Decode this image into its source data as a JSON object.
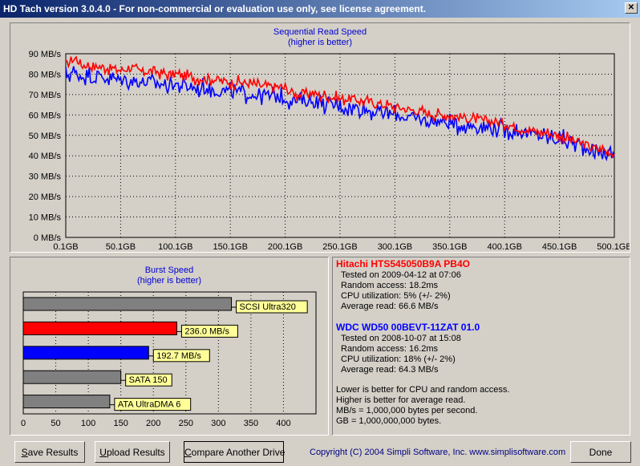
{
  "window": {
    "title": "HD Tach version 3.0.4.0  - For non-commercial or evaluation use only, see license agreement.",
    "close_glyph": "✕"
  },
  "seq_chart": {
    "title": "Sequential Read Speed",
    "subtitle": "(higher is better)",
    "y_ticks": [
      "0 MB/s",
      "10 MB/s",
      "20 MB/s",
      "30 MB/s",
      "40 MB/s",
      "50 MB/s",
      "60 MB/s",
      "70 MB/s",
      "80 MB/s",
      "90 MB/s"
    ],
    "x_ticks": [
      "0.1GB",
      "50.1GB",
      "100.1GB",
      "150.1GB",
      "200.1GB",
      "250.1GB",
      "300.1GB",
      "350.1GB",
      "400.1GB",
      "450.1GB",
      "500.1GB"
    ]
  },
  "burst_chart": {
    "title": "Burst Speed",
    "subtitle": "(higher is better)",
    "x_ticks": [
      "0",
      "50",
      "100",
      "150",
      "200",
      "250",
      "300",
      "350",
      "400"
    ]
  },
  "chart_data": [
    {
      "type": "line",
      "title": "Sequential Read Speed",
      "subtitle": "(higher is better)",
      "xlabel": "",
      "ylabel": "",
      "x_unit": "GB",
      "y_unit": "MB/s",
      "xlim": [
        0.1,
        500.1
      ],
      "ylim": [
        0,
        90
      ],
      "grid": true,
      "series": [
        {
          "name": "Hitachi HTS545050B9A PB4O",
          "color": "#ff0000",
          "x": [
            0.1,
            5,
            10,
            15,
            20,
            25,
            30,
            40,
            50,
            60,
            70,
            80,
            90,
            100,
            110,
            120,
            130,
            140,
            150,
            160,
            170,
            180,
            190,
            200,
            210,
            220,
            230,
            240,
            250,
            260,
            270,
            280,
            290,
            300,
            310,
            320,
            330,
            340,
            350,
            360,
            370,
            380,
            390,
            400,
            410,
            420,
            430,
            440,
            450,
            460,
            470,
            480,
            490,
            500.1
          ],
          "y": [
            84,
            87,
            88,
            84,
            85,
            83,
            84,
            83,
            82,
            83,
            81,
            82,
            80,
            80,
            79,
            78,
            78,
            77,
            76,
            76,
            75,
            74,
            74,
            73,
            70,
            71,
            70,
            69,
            68,
            68,
            67,
            66,
            65,
            64,
            63,
            62,
            61,
            60,
            60,
            59,
            58,
            57,
            57,
            56,
            54,
            53,
            52,
            51,
            50,
            48,
            46,
            44,
            43,
            41
          ]
        },
        {
          "name": "WDC WD50 00BEVT-11ZAT 01.0",
          "color": "#0000ff",
          "x": [
            0.1,
            5,
            10,
            15,
            20,
            25,
            30,
            40,
            50,
            60,
            70,
            80,
            90,
            100,
            110,
            120,
            130,
            140,
            150,
            160,
            170,
            180,
            190,
            200,
            210,
            220,
            230,
            240,
            250,
            260,
            270,
            280,
            290,
            300,
            310,
            320,
            330,
            340,
            350,
            360,
            370,
            380,
            390,
            400,
            410,
            420,
            430,
            440,
            450,
            460,
            470,
            480,
            490,
            500.1
          ],
          "y": [
            79,
            81,
            80,
            79,
            80,
            78,
            79,
            78,
            77,
            77,
            76,
            76,
            75,
            75,
            74,
            73,
            73,
            72,
            71,
            71,
            70,
            70,
            69,
            68,
            67,
            67,
            66,
            65,
            64,
            64,
            63,
            62,
            61,
            60,
            59,
            58,
            57,
            57,
            56,
            55,
            55,
            54,
            54,
            53,
            52,
            51,
            50,
            49,
            48,
            47,
            45,
            43,
            42,
            40
          ]
        }
      ]
    },
    {
      "type": "bar",
      "orientation": "horizontal",
      "title": "Burst Speed",
      "subtitle": "(higher is better)",
      "xlim": [
        0,
        450
      ],
      "grid": true,
      "categories": [
        "SCSI Ultra320",
        "236.0 MB/s",
        "192.7 MB/s",
        "SATA 150",
        "ATA UltraDMA 6"
      ],
      "values": [
        320,
        236.0,
        192.7,
        150,
        133
      ],
      "colors": [
        "#808080",
        "#ff0000",
        "#0000ff",
        "#808080",
        "#808080"
      ]
    }
  ],
  "results": {
    "drive1": {
      "name": "Hitachi HTS545050B9A PB4O",
      "color": "#ff0000",
      "lines": [
        "Tested on 2009-04-12 at 07:06",
        "Random access: 18.2ms",
        "CPU utilization: 5% (+/- 2%)",
        "Average read: 66.6 MB/s"
      ]
    },
    "drive2": {
      "name": "WDC WD50 00BEVT-11ZAT 01.0",
      "color": "#0000ff",
      "lines": [
        "Tested on 2008-10-07 at 15:08",
        "Random access: 16.2ms",
        "CPU utilization: 18% (+/- 2%)",
        "Average read: 64.3 MB/s"
      ]
    },
    "notes": [
      "Lower is better for CPU and random access.",
      "Higher is better for average read.",
      "MB/s = 1,000,000 bytes per second.",
      "GB = 1,000,000,000 bytes."
    ]
  },
  "buttons": {
    "save": "Save Results",
    "save_accel": "S",
    "upload": "Upload Results",
    "upload_accel": "U",
    "compare": "Compare Another Drive",
    "compare_accel": "C",
    "done": "Done"
  },
  "copyright": "Copyright (C) 2004 Simpli Software, Inc. www.simplisoftware.com"
}
